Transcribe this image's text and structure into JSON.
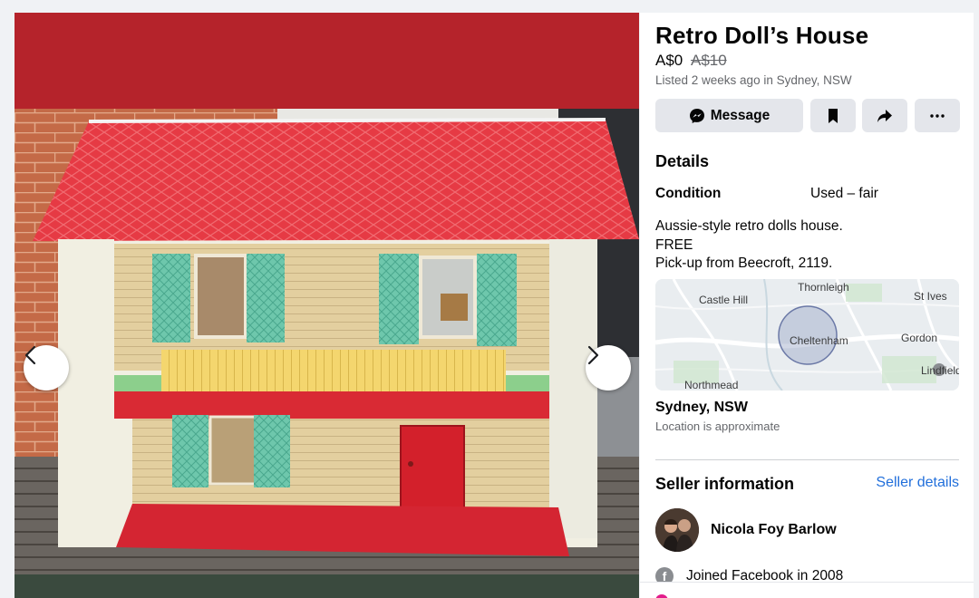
{
  "listing": {
    "title": "Retro Doll’s House",
    "price": "A$0",
    "original_price": "A$10",
    "listed": "Listed 2 weeks ago in Sydney, NSW"
  },
  "actions": {
    "message_label": "Message",
    "message_icon": "messenger-icon",
    "save_icon": "bookmark-icon",
    "share_icon": "share-icon",
    "more_icon": "more-icon"
  },
  "details": {
    "heading": "Details",
    "condition_label": "Condition",
    "condition_value": "Used – fair",
    "description": [
      "Aussie-style retro dolls house.",
      "FREE",
      "Pick-up from Beecroft, 2119."
    ]
  },
  "map": {
    "labels": {
      "castle_hill": "Castle Hill",
      "thornleigh": "Thornleigh",
      "st_ives": "St Ives",
      "cheltenham": "Cheltenham",
      "gordon": "Gordon",
      "lindfield": "Lindfield",
      "northmead": "Northmead"
    }
  },
  "location": {
    "name": "Sydney, NSW",
    "note": "Location is approximate"
  },
  "seller": {
    "heading": "Seller information",
    "details_link": "Seller details",
    "name": "Nicola Foy Barlow",
    "joined": "Joined Facebook in 2008"
  },
  "colors": {
    "accent_link": "#216fdb",
    "button_bg": "#e4e6eb",
    "roof_red": "#e8343f"
  }
}
